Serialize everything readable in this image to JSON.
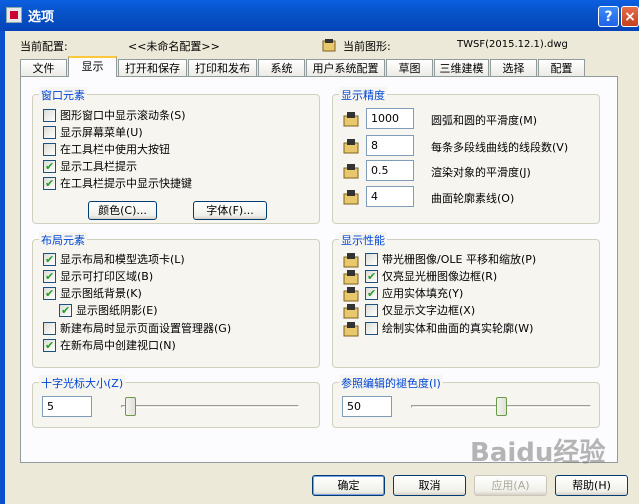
{
  "window": {
    "title": "选项"
  },
  "header": {
    "config_label": "当前配置:",
    "config_value": "<<未命名配置>>",
    "drawing_label": "当前图形:",
    "drawing_value": "TWSF(2015.12.1).dwg"
  },
  "tabs": [
    "文件",
    "显示",
    "打开和保存",
    "打印和发布",
    "系统",
    "用户系统配置",
    "草图",
    "三维建模",
    "选择",
    "配置"
  ],
  "active_tab": "显示",
  "window_elements": {
    "title": "窗口元素",
    "checks": [
      {
        "label": "图形窗口中显示滚动条(S)",
        "checked": false
      },
      {
        "label": "显示屏幕菜单(U)",
        "checked": false
      },
      {
        "label": "在工具栏中使用大按钮",
        "checked": false
      },
      {
        "label": "显示工具栏提示",
        "checked": true
      },
      {
        "label": "在工具栏提示中显示快捷键",
        "checked": true
      }
    ],
    "colors_button": "颜色(C)...",
    "fonts_button": "字体(F)..."
  },
  "layout_elements": {
    "title": "布局元素",
    "checks": [
      {
        "label": "显示布局和模型选项卡(L)",
        "checked": true
      },
      {
        "label": "显示可打印区域(B)",
        "checked": true
      },
      {
        "label": "显示图纸背景(K)",
        "checked": true
      },
      {
        "label": "显示图纸阴影(E)",
        "checked": true
      },
      {
        "label": "新建布局时显示页面设置管理器(G)",
        "checked": false
      },
      {
        "label": "在新布局中创建视口(N)",
        "checked": true
      }
    ]
  },
  "crosshair": {
    "title": "十字光标大小(Z)",
    "value": "5",
    "slider_fraction": 0.05
  },
  "display_resolution": {
    "title": "显示精度",
    "items": [
      {
        "value": "1000",
        "label": "圆弧和圆的平滑度(M)"
      },
      {
        "value": "8",
        "label": "每条多段线曲线的线段数(V)"
      },
      {
        "value": "0.5",
        "label": "渲染对象的平滑度(J)"
      },
      {
        "value": "4",
        "label": "曲面轮廓素线(O)"
      }
    ]
  },
  "display_performance": {
    "title": "显示性能",
    "checks": [
      {
        "label": "带光栅图像/OLE 平移和缩放(P)",
        "checked": false
      },
      {
        "label": "仅亮显光栅图像边框(R)",
        "checked": true
      },
      {
        "label": "应用实体填充(Y)",
        "checked": true
      },
      {
        "label": "仅显示文字边框(X)",
        "checked": false
      },
      {
        "label": "绘制实体和曲面的真实轮廓(W)",
        "checked": false
      }
    ]
  },
  "xref_fade": {
    "title": "参照编辑的褪色度(I)",
    "value": "50",
    "slider_fraction": 0.5
  },
  "footer": {
    "ok": "确定",
    "cancel": "取消",
    "apply": "应用(A)",
    "help": "帮助(H)"
  },
  "watermark": "Baidu经验",
  "colors": {
    "title_bar": "#0A5FE0",
    "group_title": "#0046D5",
    "check": "#21A121"
  }
}
